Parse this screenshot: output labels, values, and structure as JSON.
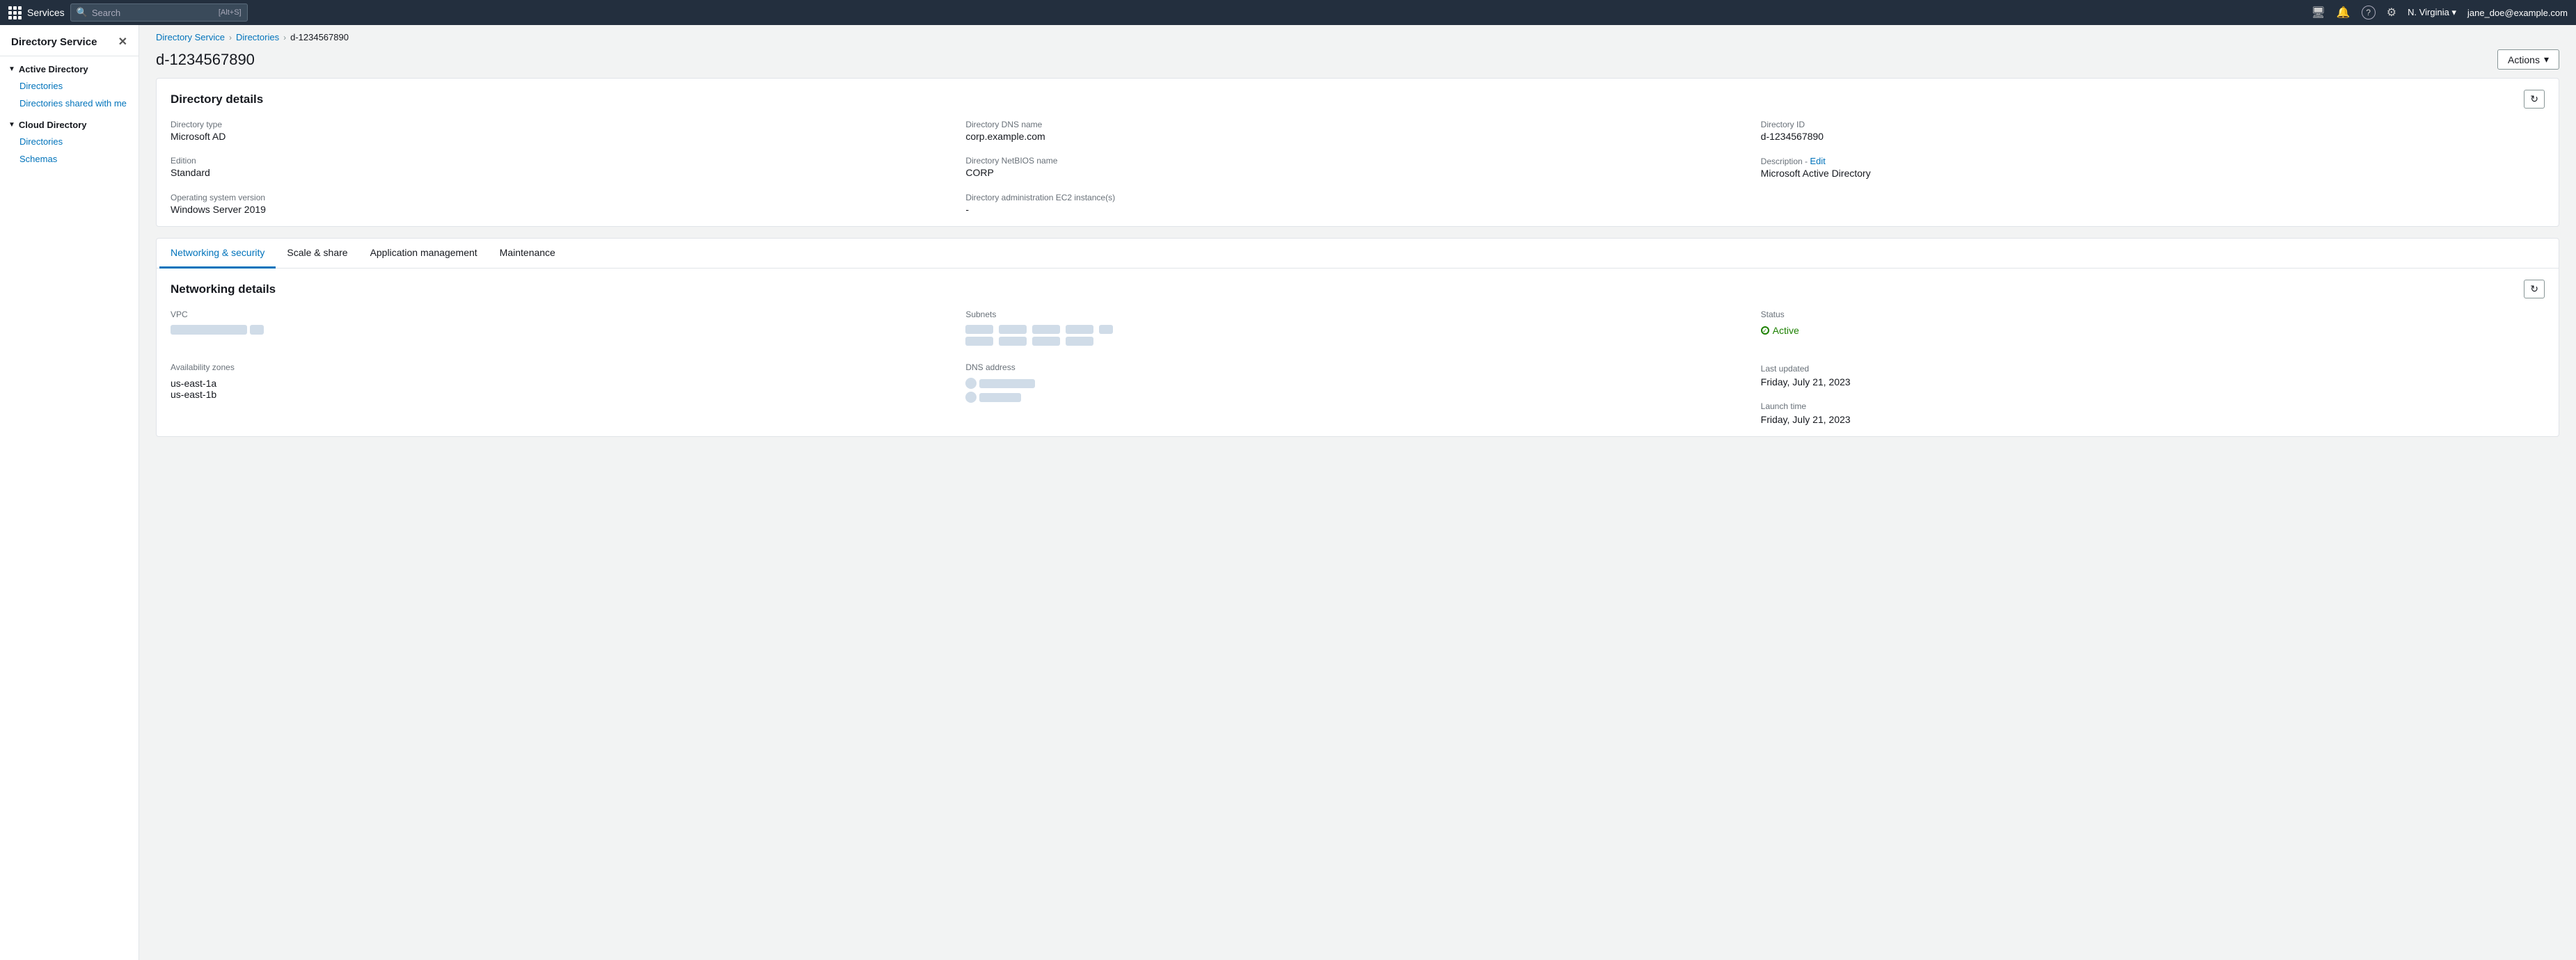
{
  "topNav": {
    "servicesLabel": "Services",
    "searchPlaceholder": "Search",
    "searchHint": "[Alt+S]",
    "region": "N. Virginia ▾",
    "user": "jane_doe@example.com"
  },
  "sidebar": {
    "title": "Directory Service",
    "closeIcon": "✕",
    "groups": [
      {
        "label": "Active Directory",
        "chevron": "▼",
        "items": [
          "Directories",
          "Directories shared with me"
        ]
      },
      {
        "label": "Cloud Directory",
        "chevron": "▼",
        "items": [
          "Directories",
          "Schemas"
        ]
      }
    ]
  },
  "breadcrumb": {
    "items": [
      "Directory Service",
      "Directories"
    ],
    "current": "d-1234567890"
  },
  "pageTitle": "d-1234567890",
  "actionsButton": "Actions",
  "directoryDetails": {
    "cardTitle": "Directory details",
    "fields": {
      "directoryType": {
        "label": "Directory type",
        "value": "Microsoft AD"
      },
      "directoryDNSName": {
        "label": "Directory DNS name",
        "value": "corp.example.com"
      },
      "directoryID": {
        "label": "Directory ID",
        "value": "d-1234567890"
      },
      "edition": {
        "label": "Edition",
        "value": "Standard"
      },
      "directoryNetBIOSName": {
        "label": "Directory NetBIOS name",
        "value": "CORP"
      },
      "descriptionLabel": "Description -",
      "editLabel": "Edit",
      "descriptionValue": "Microsoft Active Directory",
      "operatingSystemVersion": {
        "label": "Operating system version",
        "value": "Windows Server 2019"
      },
      "administrationEC2": {
        "label": "Directory administration EC2 instance(s)",
        "value": "-"
      }
    }
  },
  "tabs": [
    {
      "label": "Networking & security",
      "active": true
    },
    {
      "label": "Scale & share",
      "active": false
    },
    {
      "label": "Application management",
      "active": false
    },
    {
      "label": "Maintenance",
      "active": false
    }
  ],
  "networkingDetails": {
    "title": "Networking details",
    "vpc": {
      "label": "VPC"
    },
    "availabilityZones": {
      "label": "Availability zones",
      "values": [
        "us-east-1a",
        "us-east-1b"
      ]
    },
    "subnets": {
      "label": "Subnets"
    },
    "dnsAddress": {
      "label": "DNS address"
    },
    "status": {
      "label": "Status",
      "value": "Active"
    },
    "lastUpdated": {
      "label": "Last updated",
      "value": "Friday, July 21, 2023"
    },
    "launchTime": {
      "label": "Launch time",
      "value": "Friday, July 21, 2023"
    }
  },
  "icons": {
    "chevronDown": "▾",
    "refresh": "↻",
    "search": "🔍",
    "notification": "🔔",
    "help": "?",
    "settings": "⚙",
    "monitor": "🖥"
  }
}
